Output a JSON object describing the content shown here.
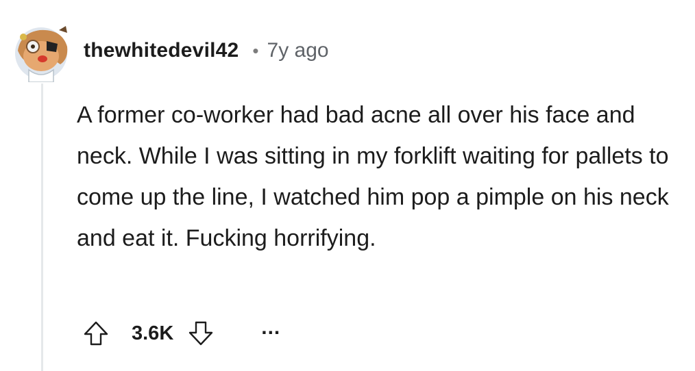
{
  "comment": {
    "author": "thewhitedevil42",
    "separator": "•",
    "timestamp": "7y ago",
    "body": "A former co-worker had bad acne all over his face and neck. While I was sitting in my forklift waiting for pallets to come up the line, I watched him pop a pimple on his neck and eat it. Fucking horrifying.",
    "score": "3.6K",
    "more_label": "..."
  },
  "icons": {
    "avatar": "snoo-avatar",
    "upvote": "upvote-arrow-icon",
    "downvote": "downvote-arrow-icon",
    "more": "more-options-icon"
  },
  "colors": {
    "text": "#1c1c1c",
    "muted": "#5f6368",
    "thread_line": "#e5e8ea",
    "background": "#ffffff"
  }
}
